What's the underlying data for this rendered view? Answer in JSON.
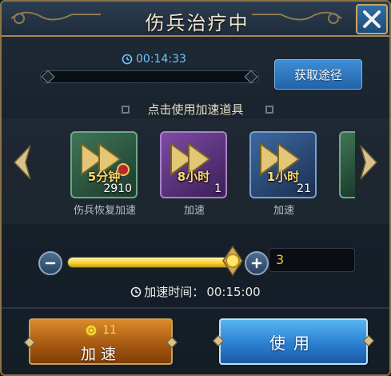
{
  "dialog": {
    "title": "伤兵治疗中",
    "close_icon": "close-icon"
  },
  "timer": {
    "remaining": "00:14:33",
    "progress": 0
  },
  "acquire_button": {
    "label": "获取途径"
  },
  "section": {
    "heading": "点击使用加速道具"
  },
  "items": [
    {
      "tag": "5分钟",
      "count": "2910",
      "label": "伤兵恢复加速",
      "color": "green"
    },
    {
      "tag": "8小时",
      "count": "1",
      "label": "加速",
      "color": "purple"
    },
    {
      "tag": "1小时",
      "count": "21",
      "label": "加速",
      "color": "blue"
    }
  ],
  "slider": {
    "value_fraction": 0.95,
    "quantity": "3"
  },
  "speedup": {
    "prefix": "加速时间：",
    "time": "00:15:00"
  },
  "buttons": {
    "speed_cost": "11",
    "speed_label": "加速",
    "use_label": "使用"
  },
  "colors": {
    "timer_text": "#6fc6ff",
    "slider_fill": "#f4cf32",
    "quantity_text": "#f2c832",
    "speed_button": "#a85a12",
    "use_button": "#2b7fd1"
  }
}
